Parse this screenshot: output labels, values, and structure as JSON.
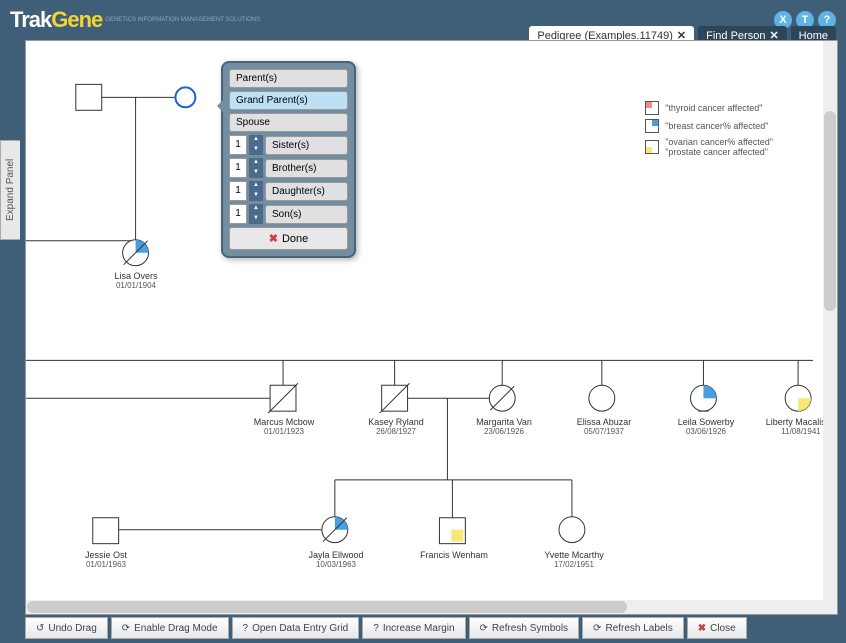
{
  "header": {
    "logo_part1": "Trak",
    "logo_part2": "Gene",
    "logo_sub": "GENETICS INFORMATION MANAGEMENT SOLUTIONS",
    "icons": [
      "X",
      "T",
      "?"
    ]
  },
  "tabs": {
    "pedigree": "Pedigree (Examples.11749)",
    "find": "Find Person",
    "home": "Home",
    "close": "✕"
  },
  "expand_panel": "Expand Panel",
  "legend": {
    "thyroid": "\"thyroid cancer affected\"",
    "breast": "\"breast cancer% affected\"",
    "ovarian": "\"ovarian cancer% affected\"",
    "prostate": "\"prostate cancer affected\""
  },
  "people": {
    "lisa": {
      "name": "Lisa Overs",
      "dob": "01/01/1904"
    },
    "marcus": {
      "name": "Marcus Mcbow",
      "dob": "01/01/1923"
    },
    "kasey": {
      "name": "Kasey Ryland",
      "dob": "26/08/1927"
    },
    "margarita": {
      "name": "Margarita Van",
      "dob": "23/06/1926"
    },
    "elissa": {
      "name": "Elissa Abuzar",
      "dob": "05/07/1937"
    },
    "leila": {
      "name": "Leila Sowerby",
      "dob": "03/06/1926"
    },
    "liberty": {
      "name": "Liberty Macalister",
      "dob": "11/08/1941"
    },
    "jessie": {
      "name": "Jessie Ost",
      "dob": "01/01/1963"
    },
    "jayla": {
      "name": "Jayla Ellwood",
      "dob": "10/03/1963"
    },
    "francis": {
      "name": "Francis Wenham",
      "dob": ""
    },
    "yvette": {
      "name": "Yvette Mcarthy",
      "dob": "17/02/1951"
    }
  },
  "popup": {
    "parents": "Parent(s)",
    "grandparents": "Grand Parent(s)",
    "spouse": "Spouse",
    "sisters": "Sister(s)",
    "brothers": "Brother(s)",
    "daughters": "Daughter(s)",
    "sons": "Son(s)",
    "done": "Done",
    "num": "1"
  },
  "footer": {
    "undo": "Undo Drag",
    "drag": "Enable Drag Mode",
    "grid": "Open Data Entry Grid",
    "margin": "Increase Margin",
    "symbols": "Refresh Symbols",
    "labels": "Refresh Labels",
    "close": "Close"
  }
}
